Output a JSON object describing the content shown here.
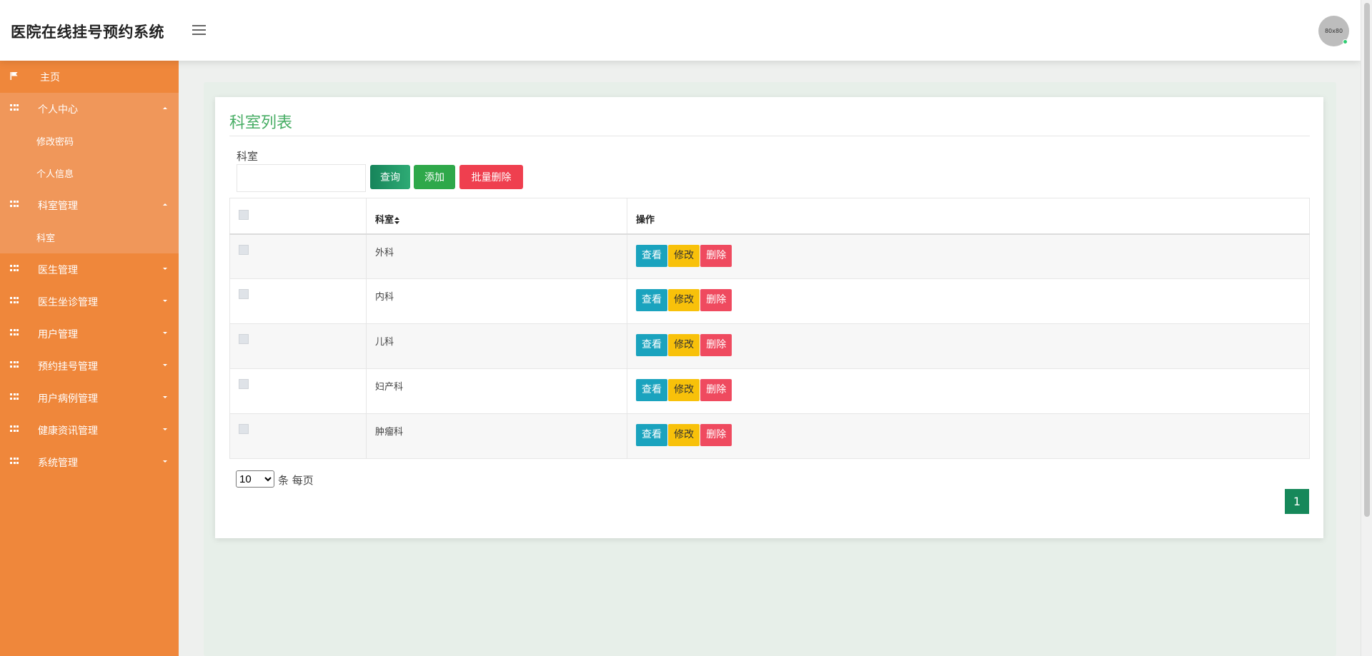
{
  "app": {
    "title": "医院在线挂号预约系统",
    "avatar_text": "80x80"
  },
  "sidebar": {
    "home": "主页",
    "personal_center": {
      "label": "个人中心",
      "items": [
        "修改密码",
        "个人信息"
      ]
    },
    "dept_mgmt": {
      "label": "科室管理",
      "items": [
        "科室"
      ]
    },
    "menus": [
      "医生管理",
      "医生坐诊管理",
      "用户管理",
      "预约挂号管理",
      "用户病例管理",
      "健康资讯管理",
      "系统管理"
    ]
  },
  "page": {
    "title": "科室列表",
    "search": {
      "label": "科室",
      "value": "",
      "placeholder": ""
    },
    "buttons": {
      "query": "查询",
      "add": "添加",
      "bulk_delete": "批量删除"
    }
  },
  "table": {
    "headers": {
      "dept": "科室",
      "ops": "操作"
    },
    "rows": [
      {
        "dept": "外科"
      },
      {
        "dept": "内科"
      },
      {
        "dept": "儿科"
      },
      {
        "dept": "妇产科"
      },
      {
        "dept": "肿瘤科"
      }
    ],
    "ops": {
      "view": "查看",
      "edit": "修改",
      "delete": "删除"
    }
  },
  "pagination": {
    "page_size": "10",
    "per_page_text": "条 每页",
    "current_page": "1"
  },
  "colors": {
    "sidebar": "#ef873b",
    "title_green": "#47ad64",
    "query_btn": "#16845a",
    "add_btn": "#2ea84a",
    "delete_btn": "#ef3f4f",
    "view_btn": "#1aa3be",
    "edit_btn": "#f8c10a"
  }
}
